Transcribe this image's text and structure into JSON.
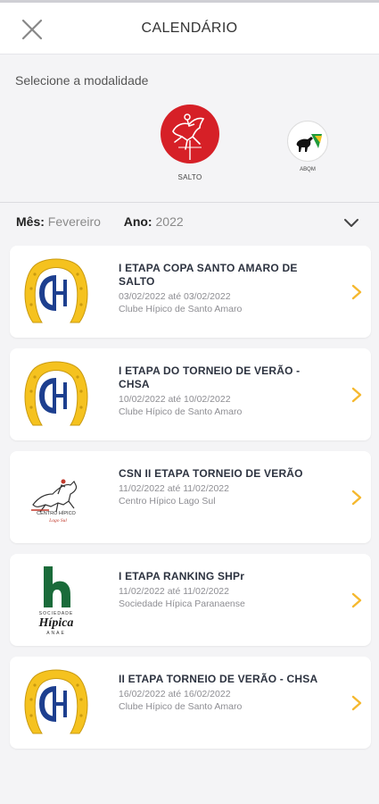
{
  "header": {
    "title": "CALENDÁRIO"
  },
  "modalities": {
    "label": "Selecione a modalidade",
    "items": [
      {
        "caption": "SALTO",
        "icon": "show-jumping-horse-icon",
        "color": "#d62027"
      },
      {
        "caption": "ABQM",
        "icon": "abqm-logo-icon"
      }
    ]
  },
  "filter": {
    "month_label": "Mês:",
    "month_value": "Fevereiro",
    "year_label": "Ano:",
    "year_value": "2022"
  },
  "accent": "#f5b82e",
  "events": [
    {
      "title": "I ETAPA COPA SANTO AMARO DE SALTO",
      "dates": "03/02/2022 até 03/02/2022",
      "club": "Clube Hípico de Santo Amaro",
      "logo": "chsa-horseshoe-logo"
    },
    {
      "title": "I ETAPA DO TORNEIO DE VERÃO - CHSA",
      "dates": "10/02/2022 até 10/02/2022",
      "club": "Clube Hípico de Santo Amaro",
      "logo": "chsa-horseshoe-logo"
    },
    {
      "title": "CSN II ETAPA TORNEIO DE VERÃO",
      "dates": "11/02/2022 até 11/02/2022",
      "club": "Centro Hípico Lago Sul",
      "logo": "centro-hipico-lago-sul-logo",
      "logo_text": "CENTRO HÍPICO Lago Sul"
    },
    {
      "title": "I ETAPA RANKING SHPr",
      "dates": "11/02/2022 até 11/02/2022",
      "club": "Sociedade Hípica Paranaense",
      "logo": "sociedade-hipica-logo",
      "logo_text": [
        "SOCIEDADE",
        "Hípica",
        "ANAE"
      ]
    },
    {
      "title": "II ETAPA TORNEIO DE VERÃO - CHSA",
      "dates": "16/02/2022 até 16/02/2022",
      "club": "Clube Hípico de Santo Amaro",
      "logo": "chsa-horseshoe-logo"
    }
  ]
}
